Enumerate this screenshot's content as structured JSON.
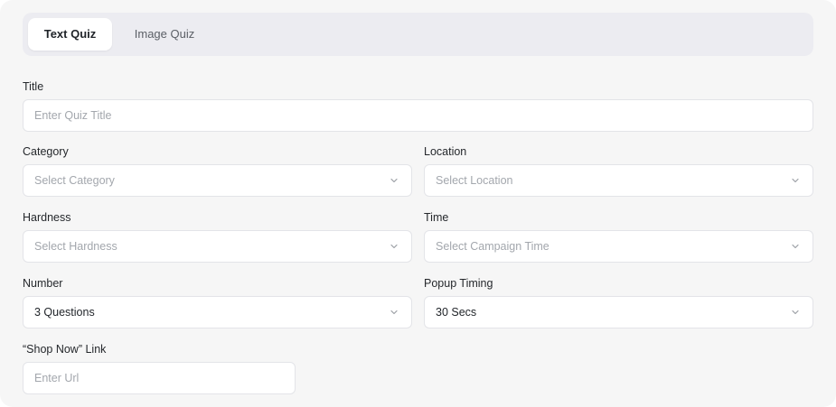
{
  "tabs": [
    {
      "label": "Text Quiz",
      "active": true
    },
    {
      "label": "Image Quiz",
      "active": false
    }
  ],
  "form": {
    "title": {
      "label": "Title",
      "placeholder": "Enter Quiz Title"
    },
    "category": {
      "label": "Category",
      "placeholder": "Select Category"
    },
    "location": {
      "label": "Location",
      "placeholder": "Select Location"
    },
    "hardness": {
      "label": "Hardness",
      "placeholder": "Select Hardness"
    },
    "time": {
      "label": "Time",
      "placeholder": "Select Campaign Time"
    },
    "number": {
      "label": "Number",
      "value": "3 Questions"
    },
    "popup_timing": {
      "label": "Popup Timing",
      "value": "30 Secs"
    },
    "shop_now_link": {
      "label": "“Shop Now” Link",
      "placeholder": "Enter Url"
    }
  },
  "icons": {
    "select_arrow": "chevron-down-icon"
  },
  "colors": {
    "panel_bg": "#f6f6f6",
    "tabbar_bg": "#ececf1",
    "field_border": "#e3e4e8",
    "placeholder": "#a3a7ad"
  }
}
